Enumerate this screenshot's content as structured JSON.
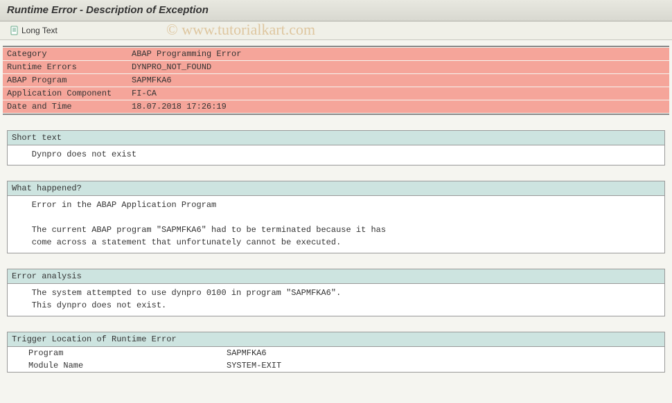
{
  "title": "Runtime Error - Description of Exception",
  "toolbar": {
    "long_text_label": "Long Text"
  },
  "summary": {
    "rows": [
      {
        "label": "Category",
        "value": "ABAP Programming Error"
      },
      {
        "label": "Runtime Errors",
        "value": "DYNPRO_NOT_FOUND"
      },
      {
        "label": "ABAP Program",
        "value": "SAPMFKA6"
      },
      {
        "label": "Application Component",
        "value": "FI-CA"
      },
      {
        "label": "Date and Time",
        "value": "18.07.2018 17:26:19"
      }
    ]
  },
  "sections": {
    "short_text": {
      "header": "Short text",
      "body": "    Dynpro does not exist"
    },
    "what_happened": {
      "header": "What happened?",
      "body": "    Error in the ABAP Application Program\n\n    The current ABAP program \"SAPMFKA6\" had to be terminated because it has\n    come across a statement that unfortunately cannot be executed."
    },
    "error_analysis": {
      "header": "Error analysis",
      "body": "    The system attempted to use dynpro 0100 in program \"SAPMFKA6\".\n    This dynpro does not exist."
    },
    "trigger_location": {
      "header": "Trigger Location of Runtime Error",
      "rows": [
        {
          "label": "Program",
          "value": "SAPMFKA6"
        },
        {
          "label": "Module Name",
          "value": "SYSTEM-EXIT"
        }
      ]
    }
  },
  "watermark": "© www.tutorialkart.com"
}
